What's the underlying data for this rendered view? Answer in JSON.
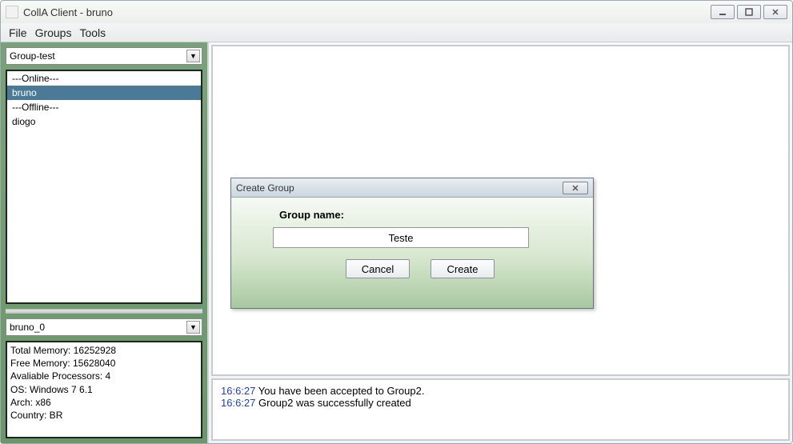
{
  "window": {
    "title": "CollA Client - bruno"
  },
  "menubar": {
    "file": "File",
    "groups": "Groups",
    "tools": "Tools"
  },
  "sidebar": {
    "group_select": "Group-test",
    "users": {
      "online_header": "---Online---",
      "online": [
        "bruno"
      ],
      "offline_header": "---Offline---",
      "offline": [
        "diogo"
      ]
    },
    "session_select": "bruno_0",
    "info": {
      "total_memory": "Total Memory: 16252928",
      "free_memory": "Free Memory: 15628040",
      "processors": "Avaliable Processors: 4",
      "os": "OS: Windows 7 6.1",
      "arch": "Arch: x86",
      "country": "Country: BR"
    }
  },
  "dialog": {
    "title": "Create Group",
    "label": "Group name:",
    "value": "Teste",
    "cancel": "Cancel",
    "create": "Create"
  },
  "log": [
    {
      "time": "16:6:27",
      "msg": "You have been accepted to Group2."
    },
    {
      "time": "16:6:27",
      "msg": "Group2 was successfully created"
    }
  ]
}
